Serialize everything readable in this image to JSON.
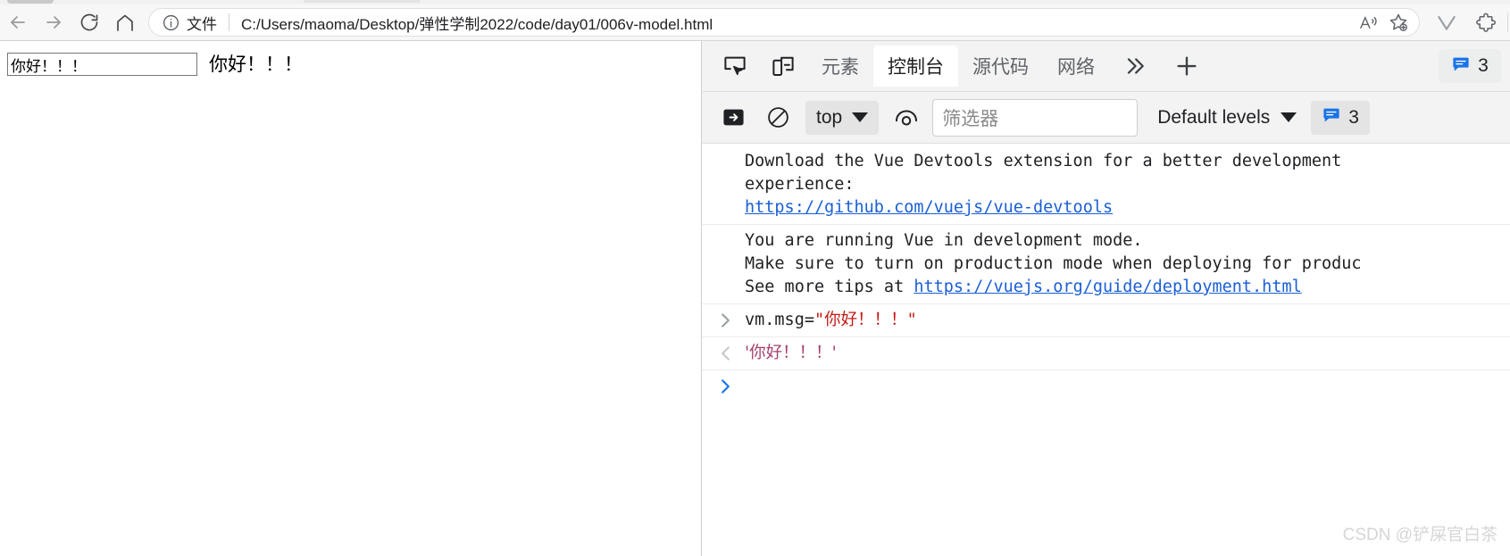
{
  "browser": {
    "nav": {
      "back_label": "Back",
      "forward_label": "Forward",
      "reload_label": "Refresh",
      "home_label": "Home"
    },
    "omnibox": {
      "scheme_label": "文件",
      "url": "C:/Users/maoma/Desktop/弹性学制2022/code/day01/006v-model.html",
      "read_aloud_label": "Read aloud",
      "favorite_label": "Add to favorites"
    },
    "toolbar": {
      "vue_extension_label": "Vue",
      "extensions_label": "Extensions"
    }
  },
  "page": {
    "input_value": "你好！！！",
    "output_text": "你好！！！"
  },
  "devtools": {
    "tools": {
      "inspect_label": "Inspect element",
      "device_toggle_label": "Toggle device toolbar"
    },
    "tabs": [
      {
        "label": "元素",
        "active": false
      },
      {
        "label": "控制台",
        "active": true
      },
      {
        "label": "源代码",
        "active": false
      },
      {
        "label": "网络",
        "active": false
      }
    ],
    "overflow_label": "More tools",
    "add_panel_label": "More tools",
    "issues_count_top": "3",
    "filterbar": {
      "sidebar_toggle_label": "Show console sidebar",
      "clear_console_label": "Clear console",
      "context_label": "top",
      "live_expression_label": "Create live expression",
      "filter_placeholder": "筛选器",
      "levels_label": "Default levels",
      "issues_count": "3"
    },
    "console": {
      "messages": [
        {
          "type": "info",
          "lines": [
            {
              "text": "Download the Vue Devtools extension for a better development"
            },
            {
              "text": "experience:"
            },
            {
              "link": "https://github.com/vuejs/vue-devtools"
            }
          ]
        },
        {
          "type": "info",
          "lines": [
            {
              "text": "You are running Vue in development mode."
            },
            {
              "text": "Make sure to turn on production mode when deploying for produc"
            },
            {
              "text": "See more tips at ",
              "link": "https://vuejs.org/guide/deployment.html"
            }
          ]
        },
        {
          "type": "command",
          "gutter": "›",
          "code_prefix": "vm.msg=",
          "code_quote": "\"",
          "code_string": "你好！！！"
        },
        {
          "type": "result",
          "gutter": "‹",
          "result": "'你好！！！'"
        }
      ],
      "prompt_symbol": "›"
    }
  },
  "watermark": "CSDN @铲屎官白茶",
  "colors": {
    "accent_blue": "#1a73e8",
    "link_blue": "#1a5fd4",
    "string_red": "#c41a16",
    "result_pink": "#a6406f",
    "chrome_bg": "#f7f7f7",
    "devtools_bg": "#f3f3f3"
  }
}
